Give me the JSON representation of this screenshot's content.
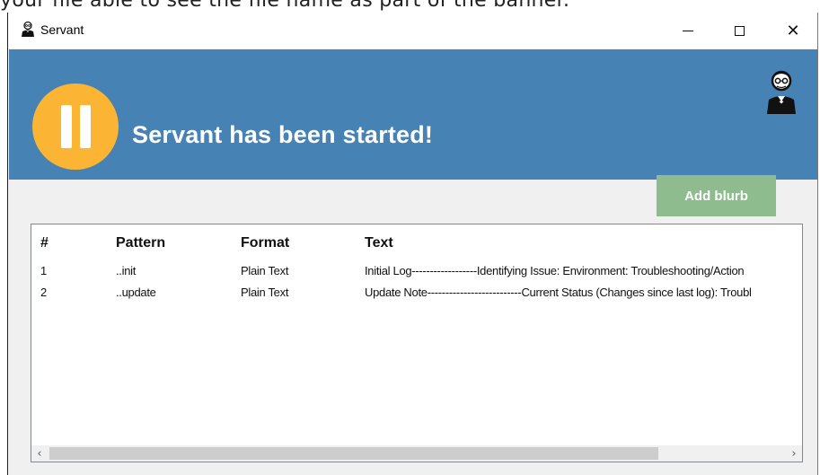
{
  "background_text": "your file able to see the file name as part of the banner.",
  "window": {
    "title": "Servant",
    "icon": "butler-icon",
    "controls": {
      "minimize": "minimize-icon",
      "maximize": "maximize-icon",
      "close": "close-icon"
    }
  },
  "banner": {
    "status_text": "Servant has been started!",
    "status_icon": "pause-icon",
    "brand_icon": "butler-icon",
    "colors": {
      "background": "#4682b4",
      "pause_circle": "#fbb433"
    }
  },
  "actions": {
    "add_blurb_label": "Add blurb",
    "add_blurb_color": "#8fbc8f"
  },
  "table": {
    "columns": [
      "#",
      "Pattern",
      "Format",
      "Text"
    ],
    "rows": [
      {
        "num": "1",
        "pattern": "..init",
        "format": "Plain Text",
        "text": "Initial Log------------------Identifying Issue: Environment: Troubleshooting/Action"
      },
      {
        "num": "2",
        "pattern": "..update",
        "format": "Plain Text",
        "text": "Update Note--------------------------Current Status (Changes since last log): Troubl"
      }
    ]
  },
  "scrollbar": {
    "left_arrow": "‹",
    "right_arrow": "›"
  }
}
